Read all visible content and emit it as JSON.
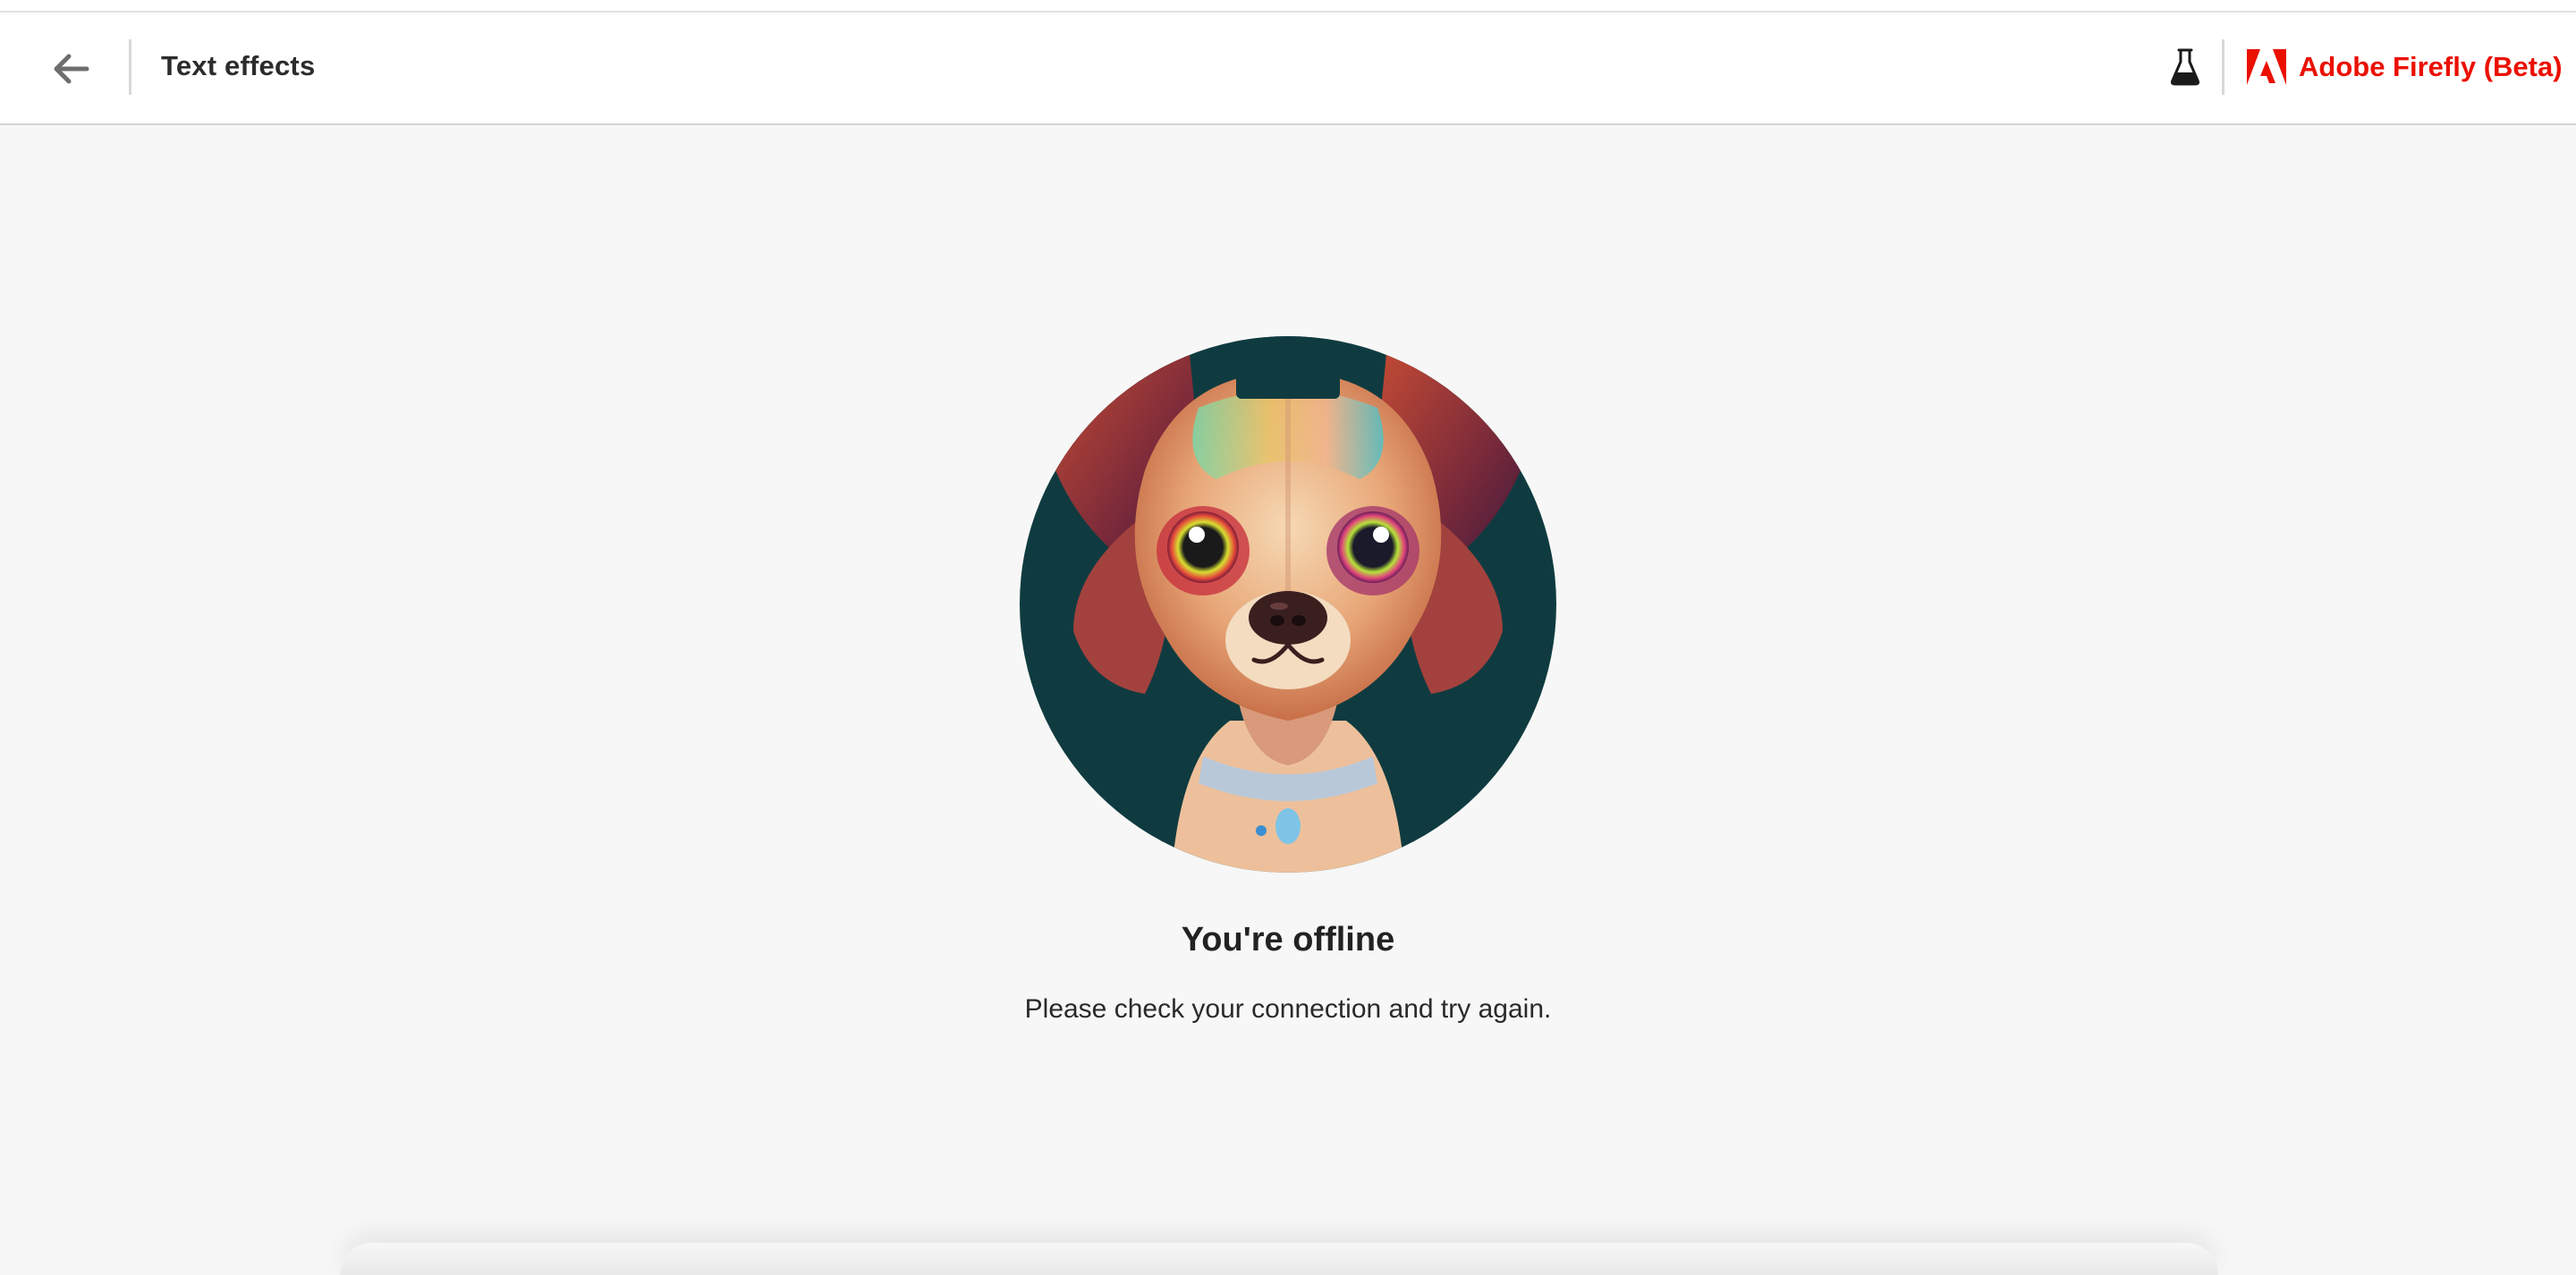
{
  "header": {
    "back_label": "Back",
    "title": "Text effects",
    "beta_icon": "flask-icon",
    "brand": {
      "logo_icon": "adobe-logo-icon",
      "name": "Adobe Firefly (Beta)",
      "color": "#eb1000"
    }
  },
  "main": {
    "illustration": "dog-illustration",
    "title": "You're offline",
    "message": "Please check your connection and try again."
  },
  "colors": {
    "background": "#f7f7f7",
    "header_background": "#ffffff",
    "accent": "#eb1000",
    "text": "#222222"
  }
}
